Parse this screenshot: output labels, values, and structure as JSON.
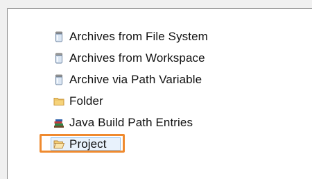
{
  "tree": {
    "items": [
      {
        "label": "Archives from File System",
        "icon": "jar-icon"
      },
      {
        "label": "Archives from Workspace",
        "icon": "jar-icon"
      },
      {
        "label": "Archive via Path Variable",
        "icon": "jar-icon"
      },
      {
        "label": "Folder",
        "icon": "folder-icon"
      },
      {
        "label": "Java Build Path Entries",
        "icon": "library-icon"
      },
      {
        "label": "Project",
        "icon": "open-folder-icon",
        "selected": true
      }
    ]
  },
  "colors": {
    "highlight_border": "#ef8a2f",
    "selection_border": "#99c4f0",
    "selection_fill": "#e8f2fc"
  }
}
